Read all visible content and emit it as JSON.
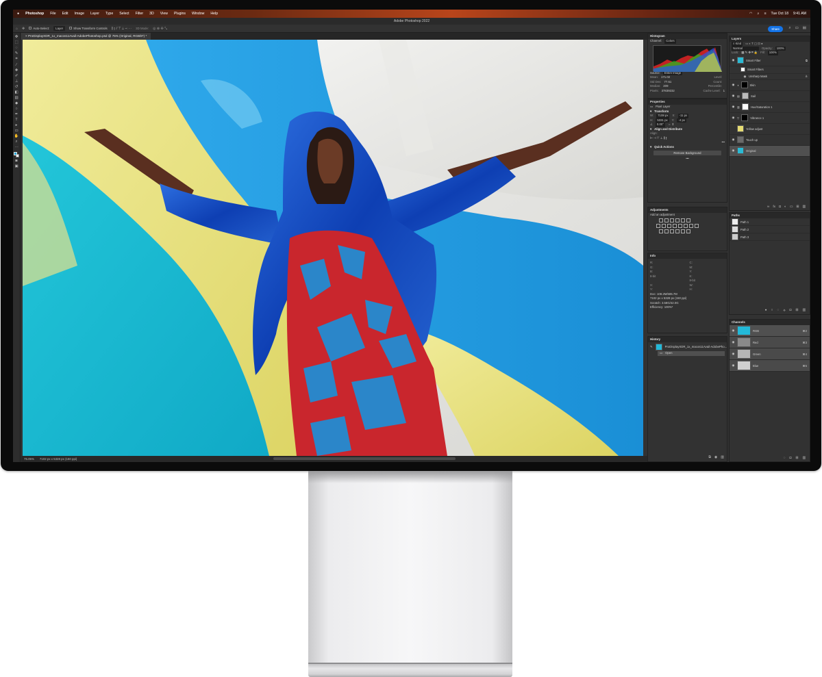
{
  "menubar": {
    "apple": "",
    "app": "Photoshop",
    "menus": [
      "File",
      "Edit",
      "Image",
      "Layer",
      "Type",
      "Select",
      "Filter",
      "3D",
      "View",
      "Plugins",
      "Window",
      "Help"
    ],
    "clock": "Tue Oct 18",
    "time": "9:41 AM"
  },
  "window": {
    "title": "Adobe Photoshop 2022"
  },
  "options": {
    "auto_select_label": "Auto-Select:",
    "auto_select_value": "Layer",
    "transform_label": "Show Transform Controls",
    "mode_3d": "3D Mode:",
    "share": "Share"
  },
  "document": {
    "tab": "ProDisplayXDR_1x_macos11Avail-AdobePhotoshop.psd @ 75% (Original, RGB/8*) *",
    "zoom": "75.05%",
    "size": "7102 px x 5328 px (150 ppi)"
  },
  "histogram": {
    "title": "Histogram",
    "channel_label": "Channel:",
    "channel_value": "Colors",
    "source_label": "Source:",
    "source_value": "Entire Image",
    "stats": [
      [
        "Mean:",
        "171.02",
        "Level:",
        ""
      ],
      [
        "Std Dev:",
        "77.61",
        "Count:",
        ""
      ],
      [
        "Median:",
        "209",
        "Percentile:",
        ""
      ],
      [
        "Pixels:",
        "37839232",
        "Cache Level:",
        "1"
      ]
    ]
  },
  "properties": {
    "title": "Properties",
    "layer_type": "Pixel Layer",
    "transform": "Transform",
    "w": "7108 px",
    "x": "-11 px",
    "h": "5331 px",
    "y": "-4 px",
    "angle": "0.00°",
    "align": "Align and Distribute",
    "align_label": "Align:",
    "quick": "Quick Actions",
    "remove_bg": "Remove Background",
    "more": "•••"
  },
  "adjustments": {
    "title": "Adjustments",
    "add": "Add an adjustment"
  },
  "info": {
    "title": "Info",
    "r": "R:",
    "g": "G:",
    "b": "B:",
    "c": "C:",
    "m": "M:",
    "y": "Y:",
    "k": "K:",
    "bit1": "8-bit",
    "bit2": "8-bit",
    "x": "X:",
    "yv": "Y:",
    "w": "W:",
    "h": "H:",
    "doc": "Doc: 108.2M/685.7M",
    "dims": "7102 px x 5328 px (150 ppi)",
    "scratch": "Scratch: 3.58G/42.0G",
    "efficiency": "Efficiency: 100%*"
  },
  "history": {
    "title": "History",
    "snapshot": "ProDisplayXDR_1x_macos11Avail-AdobePho...",
    "open": "Open"
  },
  "layers": {
    "title": "Layers",
    "kind": "Kind",
    "blend": "Normal",
    "opacity_label": "Opacity:",
    "opacity": "100%",
    "lock_label": "Lock:",
    "fill_label": "Fill:",
    "fill": "100%",
    "items": [
      {
        "name": "Smart Filter"
      },
      {
        "name": "Smart Filters"
      },
      {
        "name": "Unsharp Mask"
      },
      {
        "name": "Skin"
      },
      {
        "name": "Sail"
      },
      {
        "name": "Hue/Saturation 1"
      },
      {
        "name": "Vibrance 1"
      },
      {
        "name": "Yellow adjust"
      },
      {
        "name": "Touch up"
      },
      {
        "name": "Original"
      }
    ]
  },
  "paths": {
    "title": "Paths",
    "items": [
      "Path 1",
      "Path 2",
      "Path 3"
    ]
  },
  "channels": {
    "title": "Channels",
    "items": [
      {
        "name": "RGB",
        "key": "⌘2"
      },
      {
        "name": "Red",
        "key": "⌘3"
      },
      {
        "name": "Green",
        "key": "⌘4"
      },
      {
        "name": "Blue",
        "key": "⌘5"
      }
    ]
  }
}
